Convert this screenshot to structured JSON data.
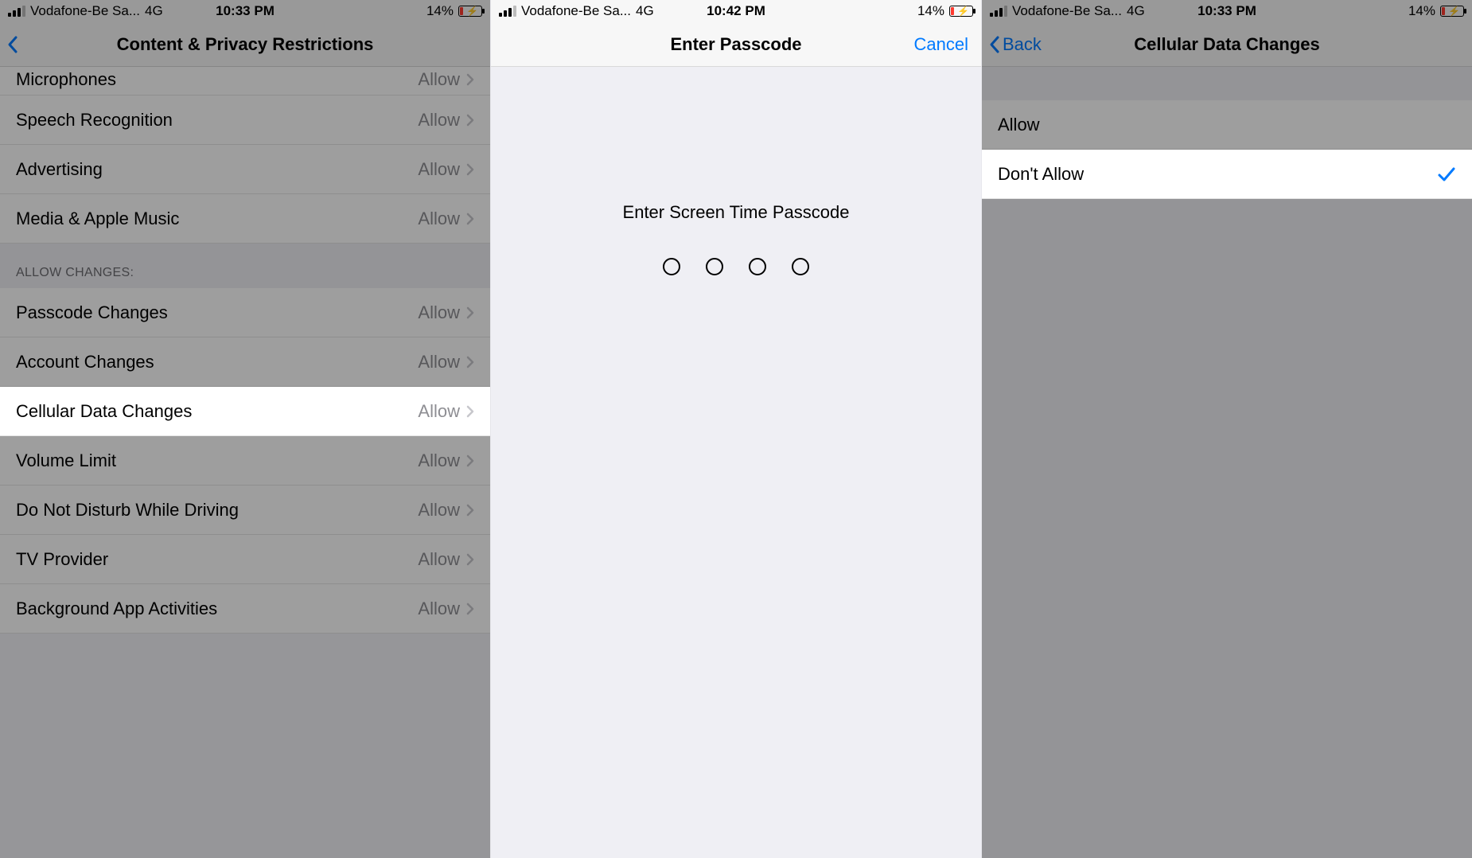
{
  "screen1": {
    "status": {
      "carrier": "Vodafone-Be Sa...",
      "network": "4G",
      "time": "10:33 PM",
      "battery_pct": "14%"
    },
    "nav": {
      "title": "Content & Privacy Restrictions"
    },
    "rows": {
      "microphone_label": "Microphones",
      "microphone_value": "Allow",
      "speech_label": "Speech Recognition",
      "speech_value": "Allow",
      "advertising_label": "Advertising",
      "advertising_value": "Allow",
      "media_label": "Media & Apple Music",
      "media_value": "Allow",
      "section_changes": "Allow Changes:",
      "passcode_label": "Passcode Changes",
      "passcode_value": "Allow",
      "account_label": "Account Changes",
      "account_value": "Allow",
      "cellular_label": "Cellular Data Changes",
      "cellular_value": "Allow",
      "volume_label": "Volume Limit",
      "volume_value": "Allow",
      "dnd_label": "Do Not Disturb While Driving",
      "dnd_value": "Allow",
      "tv_label": "TV Provider",
      "tv_value": "Allow",
      "bga_label": "Background App Activities",
      "bga_value": "Allow"
    }
  },
  "screen2": {
    "status": {
      "carrier": "Vodafone-Be Sa...",
      "network": "4G",
      "time": "10:42 PM",
      "battery_pct": "14%"
    },
    "nav": {
      "title": "Enter Passcode",
      "cancel": "Cancel"
    },
    "prompt": "Enter Screen Time Passcode"
  },
  "screen3": {
    "status": {
      "carrier": "Vodafone-Be Sa...",
      "network": "4G",
      "time": "10:33 PM",
      "battery_pct": "14%"
    },
    "nav": {
      "back": "Back",
      "title": "Cellular Data Changes"
    },
    "rows": {
      "allow_label": "Allow",
      "dont_allow_label": "Don't Allow"
    }
  },
  "colors": {
    "ios_blue": "#007aff",
    "ios_red": "#ff3b30",
    "secondary_text": "#8e8e93"
  }
}
